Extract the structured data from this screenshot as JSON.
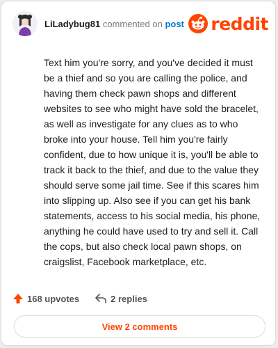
{
  "colors": {
    "brand": "#ff4500",
    "link": "#0079d3",
    "text": "#1c1c1c",
    "muted": "#7c7c7c"
  },
  "header": {
    "username": "LiLadybug81",
    "action_text": "commented on",
    "post_link": "post",
    "logo_text": "reddit",
    "avatar_icon": "avatar-figure",
    "logo_icon": "snoo-icon"
  },
  "comment": {
    "text": "Text him you're sorry, and you've decided it must be a thief and so you are calling the police, and having them check pawn shops and different websites to see who might have sold the bracelet, as well as investigate for any clues as to who broke into your house. Tell him you're fairly confident, due to how unique it is, you'll be able to track it back to the thief, and due to the value they should serve some jail time. See if this scares him into slipping up. Also see if you can get his bank statements, access to his social media, his phone, anything he could have used to try and sell it. Call the cops, but also check local pawn shops, on craigslist, Facebook marketplace, etc."
  },
  "stats": {
    "upvotes": "168 upvotes",
    "replies": "2 replies",
    "upvote_icon": "upvote-arrow-icon",
    "reply_icon": "reply-arrow-icon"
  },
  "footer": {
    "view_comments_label": "View 2 comments"
  }
}
